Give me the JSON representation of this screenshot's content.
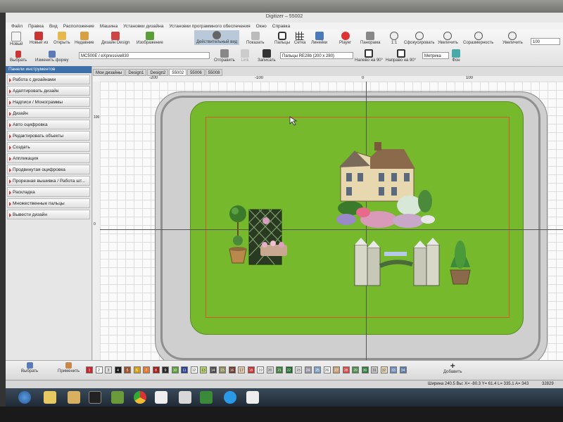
{
  "window": {
    "title": "Digitizer – 55002"
  },
  "menu": [
    "Файл",
    "Правка",
    "Вид",
    "Расположение",
    "Машина",
    "Установки дизайна",
    "Установки программного обеспечения",
    "Окно",
    "Справка"
  ],
  "ribbon": {
    "new": "Новый",
    "new_from": "Новый из",
    "open": "Открыть",
    "recent": "Недавние",
    "design": "Дизайн Design",
    "image": "Изображение",
    "real_view": "Действительный вид",
    "show": "Показать",
    "hoops": "Пальцы",
    "grid": "Сетка",
    "rulers": "Линейки",
    "player": "Player",
    "panorama": "Панорама",
    "zoom_1to1": "1:1",
    "focus": "Сфокусировать",
    "zoom_in": "Увеличить",
    "proportional": "Соразмерность",
    "zoom_out": "Увеличить",
    "zoom_value": "100",
    "select": "Выбрать",
    "modify_shape": "Изменить форму",
    "machine": "MC500E / eXpressive830",
    "send": "Отправить",
    "link": "Link",
    "write": "Записать",
    "hoop_size": "Пальцы RE28b (200 x 280)",
    "rotate_left": "Налево на 90°",
    "rotate_right": "Направо на 90°",
    "units": "Метрика",
    "background": "Фон"
  },
  "panel": {
    "header": "Панели инструментов",
    "items": [
      "Работа с дизайнами",
      "Адаптировать дизайн",
      "Надписи / Монограммы",
      "Дизайн",
      "Авто оцифровка",
      "Редактировать объекты",
      "Создать",
      "Аппликация",
      "Продвинутая оцифровка",
      "Прорезная вышивка / Работа шт...",
      "Раскладка",
      "Множественные пальцы",
      "Вывести дизайн"
    ]
  },
  "tabs": [
    "Мои дизайны",
    "Design1",
    "Design2",
    "55002",
    "55006",
    "55008"
  ],
  "rulers": {
    "h": [
      "-200",
      "-100",
      "0",
      "100"
    ],
    "v": [
      "100",
      "0"
    ]
  },
  "colorbar": {
    "select": "Выбрать",
    "apply": "Применить",
    "add": "Добавить",
    "swatches": [
      {
        "n": "1",
        "c": "#c8242a"
      },
      {
        "n": "2",
        "c": "#ffffff"
      },
      {
        "n": "3",
        "c": "#e0e0e0"
      },
      {
        "n": "4",
        "c": "#1a1a1a"
      },
      {
        "n": "5",
        "c": "#a0522d"
      },
      {
        "n": "6",
        "c": "#d4a017"
      },
      {
        "n": "7",
        "c": "#e07b39"
      },
      {
        "n": "8",
        "c": "#a31d1d"
      },
      {
        "n": "9",
        "c": "#2a2a2a"
      },
      {
        "n": "10",
        "c": "#5a9e3a"
      },
      {
        "n": "11",
        "c": "#2b3e8c"
      },
      {
        "n": "12",
        "c": "#ffffff"
      },
      {
        "n": "13",
        "c": "#b9d36c"
      },
      {
        "n": "14",
        "c": "#4a4a4a"
      },
      {
        "n": "15",
        "c": "#8c8c5a"
      },
      {
        "n": "16",
        "c": "#6b3a2a"
      },
      {
        "n": "17",
        "c": "#e6c9a8"
      },
      {
        "n": "18",
        "c": "#c93030"
      },
      {
        "n": "19",
        "c": "#ffffff"
      },
      {
        "n": "20",
        "c": "#d8d8d8"
      },
      {
        "n": "21",
        "c": "#3a7d3a"
      },
      {
        "n": "22",
        "c": "#1f6b2a"
      },
      {
        "n": "23",
        "c": "#e4e4e4"
      },
      {
        "n": "24",
        "c": "#9a9aa8"
      },
      {
        "n": "25",
        "c": "#7aa0c8"
      },
      {
        "n": "26",
        "c": "#ffffff"
      },
      {
        "n": "27",
        "c": "#c8a078"
      },
      {
        "n": "28",
        "c": "#d84848"
      },
      {
        "n": "29",
        "c": "#4a8a4a"
      },
      {
        "n": "30",
        "c": "#2a7a3a"
      },
      {
        "n": "31",
        "c": "#c8c8c8"
      },
      {
        "n": "32",
        "c": "#e8d8b8"
      },
      {
        "n": "33",
        "c": "#6a8ab8"
      },
      {
        "n": "34",
        "c": "#5a7aa8"
      }
    ]
  },
  "status": {
    "text": "Ширина 240.5 Вы: X= -80.3 Y= 61.4 L= 335.1 A= 343",
    "count": "32829"
  }
}
